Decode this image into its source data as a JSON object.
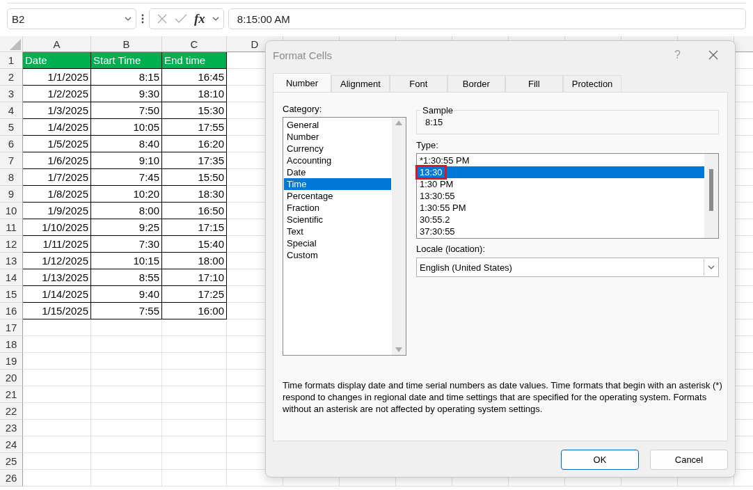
{
  "formula_bar": {
    "name_box": "B2",
    "function_label": "fx",
    "formula": "8:15:00 AM"
  },
  "sheet": {
    "columns": [
      "A",
      "B",
      "C",
      "D"
    ],
    "row_numbers": [
      "1",
      "2",
      "3",
      "4",
      "5",
      "6",
      "7",
      "8",
      "9",
      "10",
      "11",
      "12",
      "13",
      "14",
      "15",
      "16",
      "17",
      "18",
      "19",
      "20",
      "21",
      "22",
      "23",
      "24",
      "25",
      "26"
    ],
    "header": [
      "Date",
      "Start Time",
      "End time"
    ],
    "rows": [
      [
        "1/1/2025",
        "8:15",
        "16:45"
      ],
      [
        "1/2/2025",
        "9:30",
        "18:10"
      ],
      [
        "1/3/2025",
        "7:50",
        "15:30"
      ],
      [
        "1/4/2025",
        "10:05",
        "17:55"
      ],
      [
        "1/5/2025",
        "8:40",
        "16:20"
      ],
      [
        "1/6/2025",
        "9:10",
        "17:35"
      ],
      [
        "1/7/2025",
        "7:45",
        "15:50"
      ],
      [
        "1/8/2025",
        "10:20",
        "18:30"
      ],
      [
        "1/9/2025",
        "8:00",
        "16:50"
      ],
      [
        "1/10/2025",
        "9:25",
        "17:15"
      ],
      [
        "1/11/2025",
        "7:30",
        "15:40"
      ],
      [
        "1/12/2025",
        "10:15",
        "18:00"
      ],
      [
        "1/13/2025",
        "8:55",
        "17:10"
      ],
      [
        "1/14/2025",
        "9:40",
        "17:25"
      ],
      [
        "1/15/2025",
        "7:55",
        "16:00"
      ]
    ]
  },
  "dialog": {
    "title": "Format Cells",
    "help": "?",
    "tabs": [
      {
        "label": "Number",
        "selected": true
      },
      {
        "label": "Alignment",
        "selected": false
      },
      {
        "label": "Font",
        "selected": false
      },
      {
        "label": "Border",
        "selected": false
      },
      {
        "label": "Fill",
        "selected": false
      },
      {
        "label": "Protection",
        "selected": false
      }
    ],
    "category_label": "Category:",
    "categories": [
      {
        "label": "General",
        "selected": false
      },
      {
        "label": "Number",
        "selected": false
      },
      {
        "label": "Currency",
        "selected": false
      },
      {
        "label": "Accounting",
        "selected": false
      },
      {
        "label": "Date",
        "selected": false
      },
      {
        "label": "Time",
        "selected": true
      },
      {
        "label": "Percentage",
        "selected": false
      },
      {
        "label": "Fraction",
        "selected": false
      },
      {
        "label": "Scientific",
        "selected": false
      },
      {
        "label": "Text",
        "selected": false
      },
      {
        "label": "Special",
        "selected": false
      },
      {
        "label": "Custom",
        "selected": false
      }
    ],
    "sample_label": "Sample",
    "sample": "8:15",
    "type_label": "Type:",
    "types": [
      {
        "label": "*1:30:55 PM",
        "selected": false,
        "outlined": false
      },
      {
        "label": "13:30",
        "selected": true,
        "outlined": true
      },
      {
        "label": "1:30 PM",
        "selected": false,
        "outlined": false
      },
      {
        "label": "13:30:55",
        "selected": false,
        "outlined": false
      },
      {
        "label": "1:30:55 PM",
        "selected": false,
        "outlined": false
      },
      {
        "label": "30:55.2",
        "selected": false,
        "outlined": false
      },
      {
        "label": "37:30:55",
        "selected": false,
        "outlined": false
      }
    ],
    "locale_label": "Locale (location):",
    "locale": "English (United States)",
    "description": "Time formats display date and time serial numbers as date values.  Time formats that begin with an asterisk (*) respond to changes in regional date and time settings that are specified for the operating system. Formats without an asterisk are not affected by operating system settings.",
    "buttons": [
      {
        "label": "OK",
        "default": true
      },
      {
        "label": "Cancel",
        "default": false
      }
    ]
  }
}
